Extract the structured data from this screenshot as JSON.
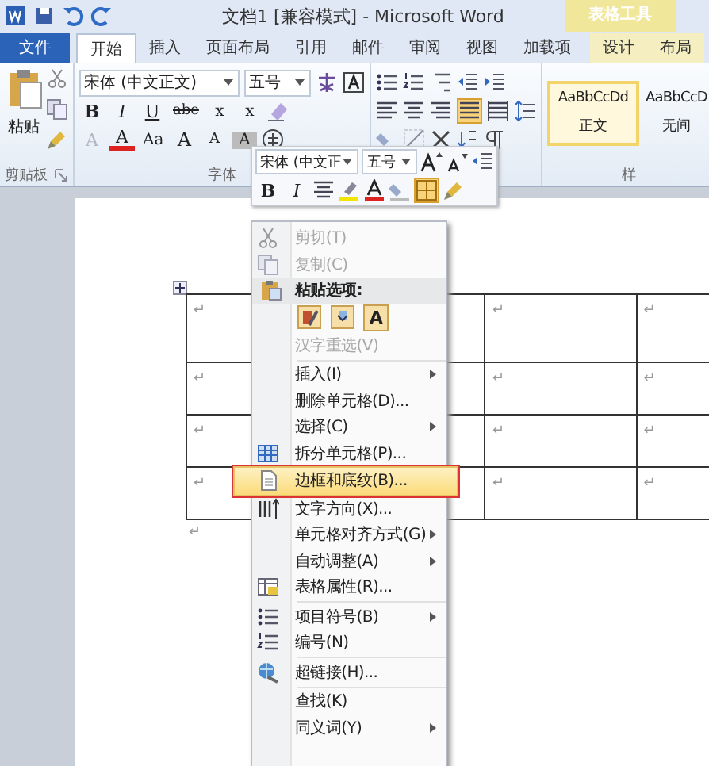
{
  "window": {
    "title": "文档1 [兼容模式] - Microsoft Word"
  },
  "contextual_group": {
    "label": "表格工具"
  },
  "tabs": [
    {
      "label": "文件",
      "kind": "file",
      "selected": false
    },
    {
      "label": "开始",
      "kind": "main",
      "selected": true
    },
    {
      "label": "插入",
      "kind": "main",
      "selected": false
    },
    {
      "label": "页面布局",
      "kind": "main",
      "selected": false
    },
    {
      "label": "引用",
      "kind": "main",
      "selected": false
    },
    {
      "label": "邮件",
      "kind": "main",
      "selected": false
    },
    {
      "label": "审阅",
      "kind": "main",
      "selected": false
    },
    {
      "label": "视图",
      "kind": "main",
      "selected": false
    },
    {
      "label": "加载项",
      "kind": "main",
      "selected": false
    },
    {
      "label": "设计",
      "kind": "contextual",
      "selected": false
    },
    {
      "label": "布局",
      "kind": "contextual",
      "selected": false
    }
  ],
  "ribbon": {
    "clipboard": {
      "paste_label": "粘贴",
      "group_label": "剪贴板"
    },
    "font": {
      "font_name": "宋体 (中文正文)",
      "font_size": "五号",
      "group_label": "字体",
      "format_buttons": [
        {
          "label": "B",
          "kind": "bold"
        },
        {
          "label": "I",
          "kind": "italic"
        },
        {
          "label": "U",
          "kind": "underline"
        },
        {
          "label": "abe",
          "kind": "strike"
        },
        {
          "label": "x",
          "kind": "sub"
        },
        {
          "label": "x",
          "kind": "sup"
        }
      ],
      "color_buttons": [
        {
          "label": "A",
          "kind": "effect"
        },
        {
          "label": "A",
          "kind": "color"
        },
        {
          "label": "Aa",
          "kind": "case"
        },
        {
          "label": "A",
          "kind": "grow"
        },
        {
          "label": "A",
          "kind": "shrink"
        },
        {
          "label": "A",
          "kind": "shade"
        }
      ]
    },
    "styles": {
      "group_label": "样",
      "items": [
        {
          "sample": "AaBbCcDd",
          "name": "正文",
          "selected": true
        },
        {
          "sample": "AaBbCcD",
          "name": "无间",
          "selected": false
        }
      ]
    }
  },
  "mini_toolbar": {
    "font_name": "宋体 (中文正",
    "font_size": "五号",
    "buttons": [
      {
        "label": "B",
        "kind": "bold"
      },
      {
        "label": "I",
        "kind": "italic"
      }
    ]
  },
  "table": {
    "rows": [
      [
        "↵",
        "↵",
        "↵"
      ],
      [
        "↵",
        "↵",
        "↵"
      ],
      [
        "↵",
        "↵",
        "↵"
      ],
      [
        "↵",
        "↵",
        "↵"
      ]
    ],
    "after_mark": "↵"
  },
  "context_menu": [
    {
      "kind": "item",
      "label": "剪切(T)",
      "disabled": true
    },
    {
      "kind": "item",
      "label": "复制(C)",
      "disabled": true
    },
    {
      "kind": "header",
      "label": "粘贴选项:"
    },
    {
      "kind": "paste_options",
      "text_button": "A"
    },
    {
      "kind": "item",
      "label": "汉字重选(V)",
      "disabled": true
    },
    {
      "kind": "separator"
    },
    {
      "kind": "item",
      "label": "插入(I)",
      "submenu": true
    },
    {
      "kind": "item",
      "label": "删除单元格(D)..."
    },
    {
      "kind": "item",
      "label": "选择(C)",
      "submenu": true
    },
    {
      "kind": "item",
      "label": "拆分单元格(P)..."
    },
    {
      "kind": "item",
      "label": "边框和底纹(B)...",
      "selected": true,
      "outlined": true
    },
    {
      "kind": "item",
      "label": "文字方向(X)..."
    },
    {
      "kind": "item",
      "label": "单元格对齐方式(G)",
      "submenu": true
    },
    {
      "kind": "item",
      "label": "自动调整(A)",
      "submenu": true
    },
    {
      "kind": "item",
      "label": "表格属性(R)..."
    },
    {
      "kind": "separator"
    },
    {
      "kind": "item",
      "label": "项目符号(B)",
      "submenu": true
    },
    {
      "kind": "item",
      "label": "编号(N)"
    },
    {
      "kind": "separator"
    },
    {
      "kind": "item",
      "label": "超链接(H)..."
    },
    {
      "kind": "separator"
    },
    {
      "kind": "item",
      "label": "查找(K)"
    },
    {
      "kind": "item",
      "label": "同义词(Y)",
      "submenu": true
    }
  ]
}
